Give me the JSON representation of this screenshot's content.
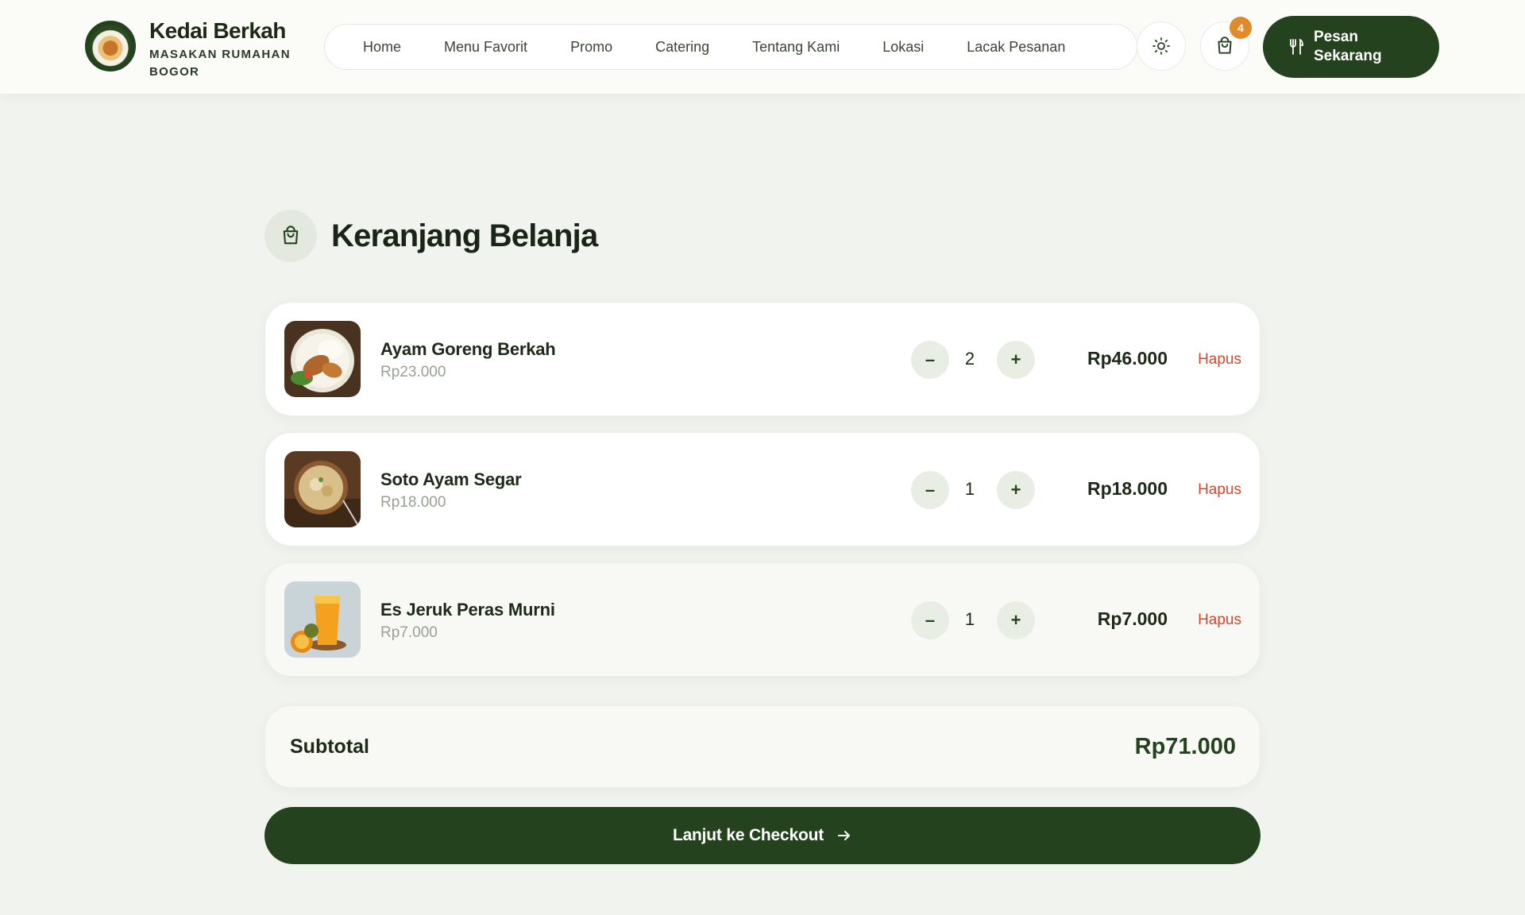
{
  "brand": {
    "title": "Kedai Berkah",
    "subtitle": "MASAKAN RUMAHAN BOGOR"
  },
  "nav": {
    "items": [
      "Home",
      "Menu Favorit",
      "Promo",
      "Catering",
      "Tentang Kami",
      "Lokasi",
      "Lacak Pesanan"
    ]
  },
  "header": {
    "cart_count": "4",
    "order_button": "Pesan Sekarang"
  },
  "cart": {
    "title": "Keranjang Belanja",
    "items": [
      {
        "name": "Ayam Goreng Berkah",
        "unit_price": "Rp23.000",
        "qty": "2",
        "total": "Rp46.000",
        "remove": "Hapus"
      },
      {
        "name": "Soto Ayam Segar",
        "unit_price": "Rp18.000",
        "qty": "1",
        "total": "Rp18.000",
        "remove": "Hapus"
      },
      {
        "name": "Es Jeruk Peras Murni",
        "unit_price": "Rp7.000",
        "qty": "1",
        "total": "Rp7.000",
        "remove": "Hapus"
      }
    ],
    "minus": "–",
    "plus": "+",
    "subtotal_label": "Subtotal",
    "subtotal_value": "Rp71.000",
    "checkout": "Lanjut ke Checkout"
  },
  "colors": {
    "primary": "#24421e",
    "badge": "#e08a2c",
    "danger": "#d2472b",
    "background": "#f1f3ef"
  },
  "icons": {
    "theme": "sun-icon",
    "cart": "shopping-bag-icon",
    "order": "utensils-icon",
    "checkout": "arrow-right-icon"
  }
}
